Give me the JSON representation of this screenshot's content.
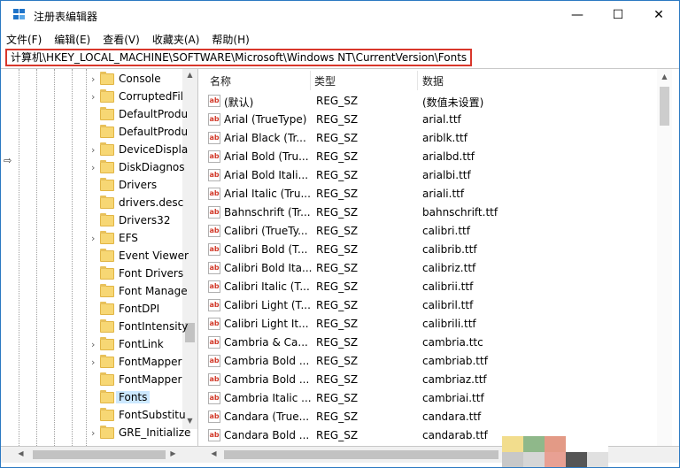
{
  "title": "注册表编辑器",
  "window_controls": {
    "minimize": "—",
    "maximize": "☐",
    "close": "✕"
  },
  "menu": [
    "文件(F)",
    "编辑(E)",
    "查看(V)",
    "收藏夹(A)",
    "帮助(H)"
  ],
  "address": "计算机\\HKEY_LOCAL_MACHINE\\SOFTWARE\\Microsoft\\Windows NT\\CurrentVersion\\Fonts",
  "tree_items": [
    {
      "label": "Console",
      "expandable": true
    },
    {
      "label": "CorruptedFil",
      "expandable": true
    },
    {
      "label": "DefaultProdu",
      "expandable": false
    },
    {
      "label": "DefaultProdu",
      "expandable": false
    },
    {
      "label": "DeviceDispla",
      "expandable": true
    },
    {
      "label": "DiskDiagnos",
      "expandable": true
    },
    {
      "label": "Drivers",
      "expandable": false
    },
    {
      "label": "drivers.desc",
      "expandable": false
    },
    {
      "label": "Drivers32",
      "expandable": false
    },
    {
      "label": "EFS",
      "expandable": true
    },
    {
      "label": "Event Viewer",
      "expandable": false
    },
    {
      "label": "Font Drivers",
      "expandable": false
    },
    {
      "label": "Font Manage",
      "expandable": false
    },
    {
      "label": "FontDPI",
      "expandable": false
    },
    {
      "label": "FontIntensity",
      "expandable": false
    },
    {
      "label": "FontLink",
      "expandable": true
    },
    {
      "label": "FontMapper",
      "expandable": true
    },
    {
      "label": "FontMapper",
      "expandable": false
    },
    {
      "label": "Fonts",
      "expandable": false,
      "selected": true
    },
    {
      "label": "FontSubstitu",
      "expandable": false
    },
    {
      "label": "GRE_Initialize",
      "expandable": true
    }
  ],
  "columns": {
    "name": "名称",
    "type": "类型",
    "data": "数据"
  },
  "values": [
    {
      "name": "(默认)",
      "type": "REG_SZ",
      "data": "(数值未设置)"
    },
    {
      "name": "Arial (TrueType)",
      "type": "REG_SZ",
      "data": "arial.ttf"
    },
    {
      "name": "Arial Black (Tr...",
      "type": "REG_SZ",
      "data": "ariblk.ttf"
    },
    {
      "name": "Arial Bold (Tru...",
      "type": "REG_SZ",
      "data": "arialbd.ttf"
    },
    {
      "name": "Arial Bold Itali...",
      "type": "REG_SZ",
      "data": "arialbi.ttf"
    },
    {
      "name": "Arial Italic (Tru...",
      "type": "REG_SZ",
      "data": "ariali.ttf"
    },
    {
      "name": "Bahnschrift (Tr...",
      "type": "REG_SZ",
      "data": "bahnschrift.ttf"
    },
    {
      "name": "Calibri (TrueTy...",
      "type": "REG_SZ",
      "data": "calibri.ttf"
    },
    {
      "name": "Calibri Bold (T...",
      "type": "REG_SZ",
      "data": "calibrib.ttf"
    },
    {
      "name": "Calibri Bold Ita...",
      "type": "REG_SZ",
      "data": "calibriz.ttf"
    },
    {
      "name": "Calibri Italic (T...",
      "type": "REG_SZ",
      "data": "calibrii.ttf"
    },
    {
      "name": "Calibri Light (T...",
      "type": "REG_SZ",
      "data": "calibril.ttf"
    },
    {
      "name": "Calibri Light It...",
      "type": "REG_SZ",
      "data": "calibrili.ttf"
    },
    {
      "name": "Cambria & Ca...",
      "type": "REG_SZ",
      "data": "cambria.ttc"
    },
    {
      "name": "Cambria Bold ...",
      "type": "REG_SZ",
      "data": "cambriab.ttf"
    },
    {
      "name": "Cambria Bold ...",
      "type": "REG_SZ",
      "data": "cambriaz.ttf"
    },
    {
      "name": "Cambria Italic ...",
      "type": "REG_SZ",
      "data": "cambriai.ttf"
    },
    {
      "name": "Candara (True...",
      "type": "REG_SZ",
      "data": "candara.ttf"
    },
    {
      "name": "Candara Bold ...",
      "type": "REG_SZ",
      "data": "candarab.ttf"
    }
  ],
  "value_icon": "ab",
  "colors": {
    "accent": "#2b79c2",
    "highlight_border": "#d9372b",
    "selection": "#cce8ff",
    "folder": "#f7d774"
  },
  "swatches": [
    "#f2dd8d",
    "#8fb88a",
    "#e39a86",
    "#ffffff",
    "#ffffff",
    "#c8c8c8",
    "#d6d6d6",
    "#e8a093",
    "#555555",
    "#e0e0e0"
  ]
}
